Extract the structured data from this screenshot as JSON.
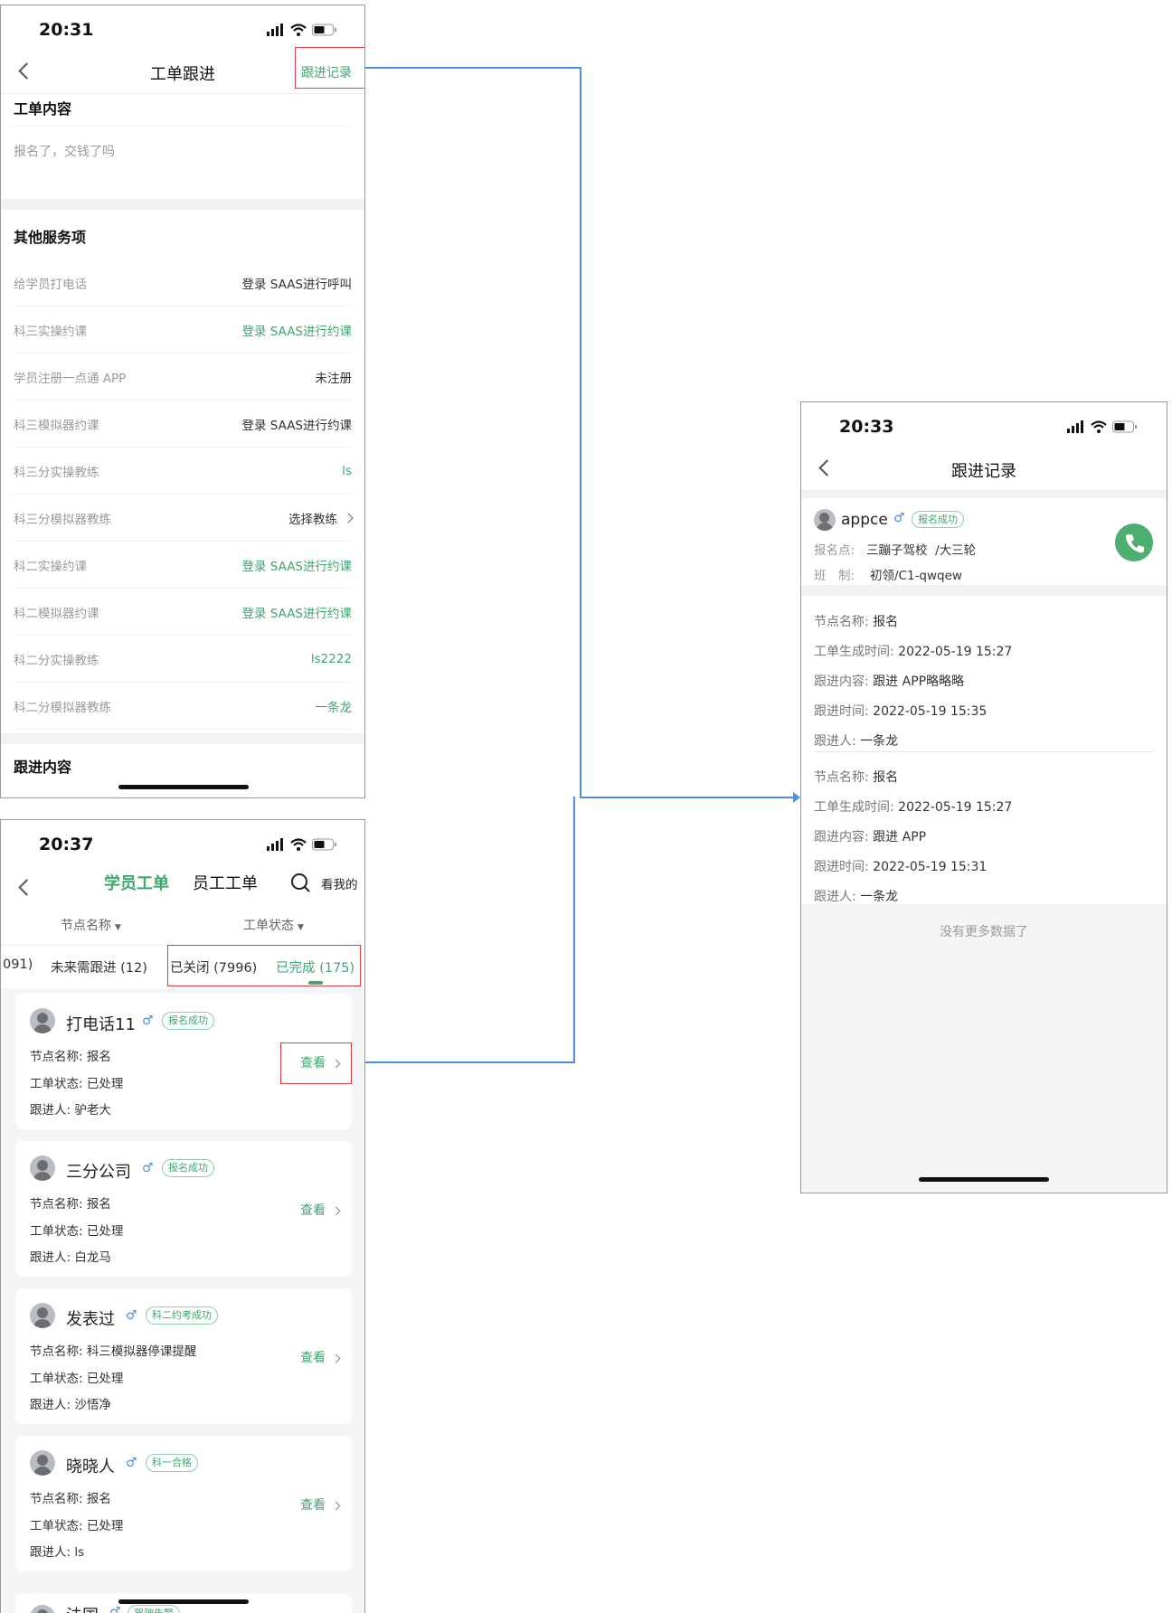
{
  "phone1": {
    "time": "20:31",
    "title": "工单跟进",
    "action": "跟进记录",
    "section_content": "工单内容",
    "content_text": "报名了，交钱了吗",
    "section_other": "其他服务项",
    "services": [
      {
        "label": "给学员打电话",
        "value": "登录 SAAS进行呼叫",
        "green": false
      },
      {
        "label": "科三实操约课",
        "value": "登录 SAAS进行约课",
        "green": true
      },
      {
        "label": "学员注册一点通 APP",
        "value": "未注册",
        "green": false
      },
      {
        "label": "科三模拟器约课",
        "value": "登录 SAAS进行约课",
        "green": false
      },
      {
        "label": "科三分实操教练",
        "value": "ls",
        "green": true
      },
      {
        "label": "科三分模拟器教练",
        "value": "选择教练",
        "green": false
      },
      {
        "label": "科二实操约课",
        "value": "登录 SAAS进行约课",
        "green": true
      },
      {
        "label": "科二模拟器约课",
        "value": "登录 SAAS进行约课",
        "green": true
      },
      {
        "label": "科二分实操教练",
        "value": "ls2222",
        "green": true
      },
      {
        "label": "科二分模拟器教练",
        "value": "一条龙",
        "green": true
      }
    ],
    "section_follow": "跟进内容"
  },
  "phone2": {
    "time": "20:37",
    "tab_student": "学员工单",
    "tab_staff": "员工工单",
    "see_mine": "看我的",
    "filter_node": "节点名称",
    "filter_status": "工单状态",
    "status_tabs": [
      "091)",
      "未来需跟进 (12)",
      "已关闭 (7996)",
      "已完成 (175)"
    ],
    "view_label": "查看",
    "cards": [
      {
        "name": "打电话11",
        "tag": "报名成功",
        "node_label": "节点名称:",
        "node": "报名",
        "status_label": "工单状态:",
        "status": "已处理",
        "follower_label": "跟进人:",
        "follower": "驴老大"
      },
      {
        "name": "三分公司",
        "tag": "报名成功",
        "node_label": "节点名称:",
        "node": "报名",
        "status_label": "工单状态:",
        "status": "已处理",
        "follower_label": "跟进人:",
        "follower": "白龙马"
      },
      {
        "name": "发表过",
        "tag": "科二约考成功",
        "node_label": "节点名称:",
        "node": "科三模拟器停课提醒",
        "status_label": "工单状态:",
        "status": "已处理",
        "follower_label": "跟进人:",
        "follower": "沙悟净"
      },
      {
        "name": "晓晓人",
        "tag": "科一合格",
        "node_label": "节点名称:",
        "node": "报名",
        "status_label": "工单状态:",
        "status": "已处理",
        "follower_label": "跟进人:",
        "follower": "ls"
      }
    ],
    "partial_name": "法国",
    "partial_tag": "驾驶告警"
  },
  "phone3": {
    "time": "20:33",
    "title": "跟进记录",
    "student_name": "appce",
    "tag": "报名成功",
    "site_label": "报名点:",
    "site_value": "三蹦子驾校  /大三轮",
    "class_label": "班　制:",
    "class_value": "初领/C1-qwqew",
    "records": [
      [
        {
          "label": "节点名称:",
          "value": "报名"
        },
        {
          "label": "工单生成时间:",
          "value": "2022-05-19 15:27"
        },
        {
          "label": "跟进内容:",
          "value": "跟进 APP略略略"
        },
        {
          "label": "跟进时间:",
          "value": "2022-05-19 15:35"
        },
        {
          "label": "跟进人:",
          "value": "一条龙"
        }
      ],
      [
        {
          "label": "节点名称:",
          "value": "报名"
        },
        {
          "label": "工单生成时间:",
          "value": "2022-05-19 15:27"
        },
        {
          "label": "跟进内容:",
          "value": "跟进 APP"
        },
        {
          "label": "跟进时间:",
          "value": "2022-05-19 15:31"
        },
        {
          "label": "跟进人:",
          "value": "一条龙"
        }
      ]
    ],
    "no_more": "没有更多数据了"
  },
  "colors": {
    "accent": "#3fa66f",
    "highlight": "#e0393e",
    "connector": "#4a90e2",
    "phone_button": "#4caf6f"
  },
  "icons": [
    "back-icon",
    "signal-icon",
    "wifi-icon",
    "battery-icon",
    "search-icon",
    "dropdown-icon",
    "chevron-right-icon",
    "male-icon",
    "avatar-icon",
    "phone-icon"
  ]
}
